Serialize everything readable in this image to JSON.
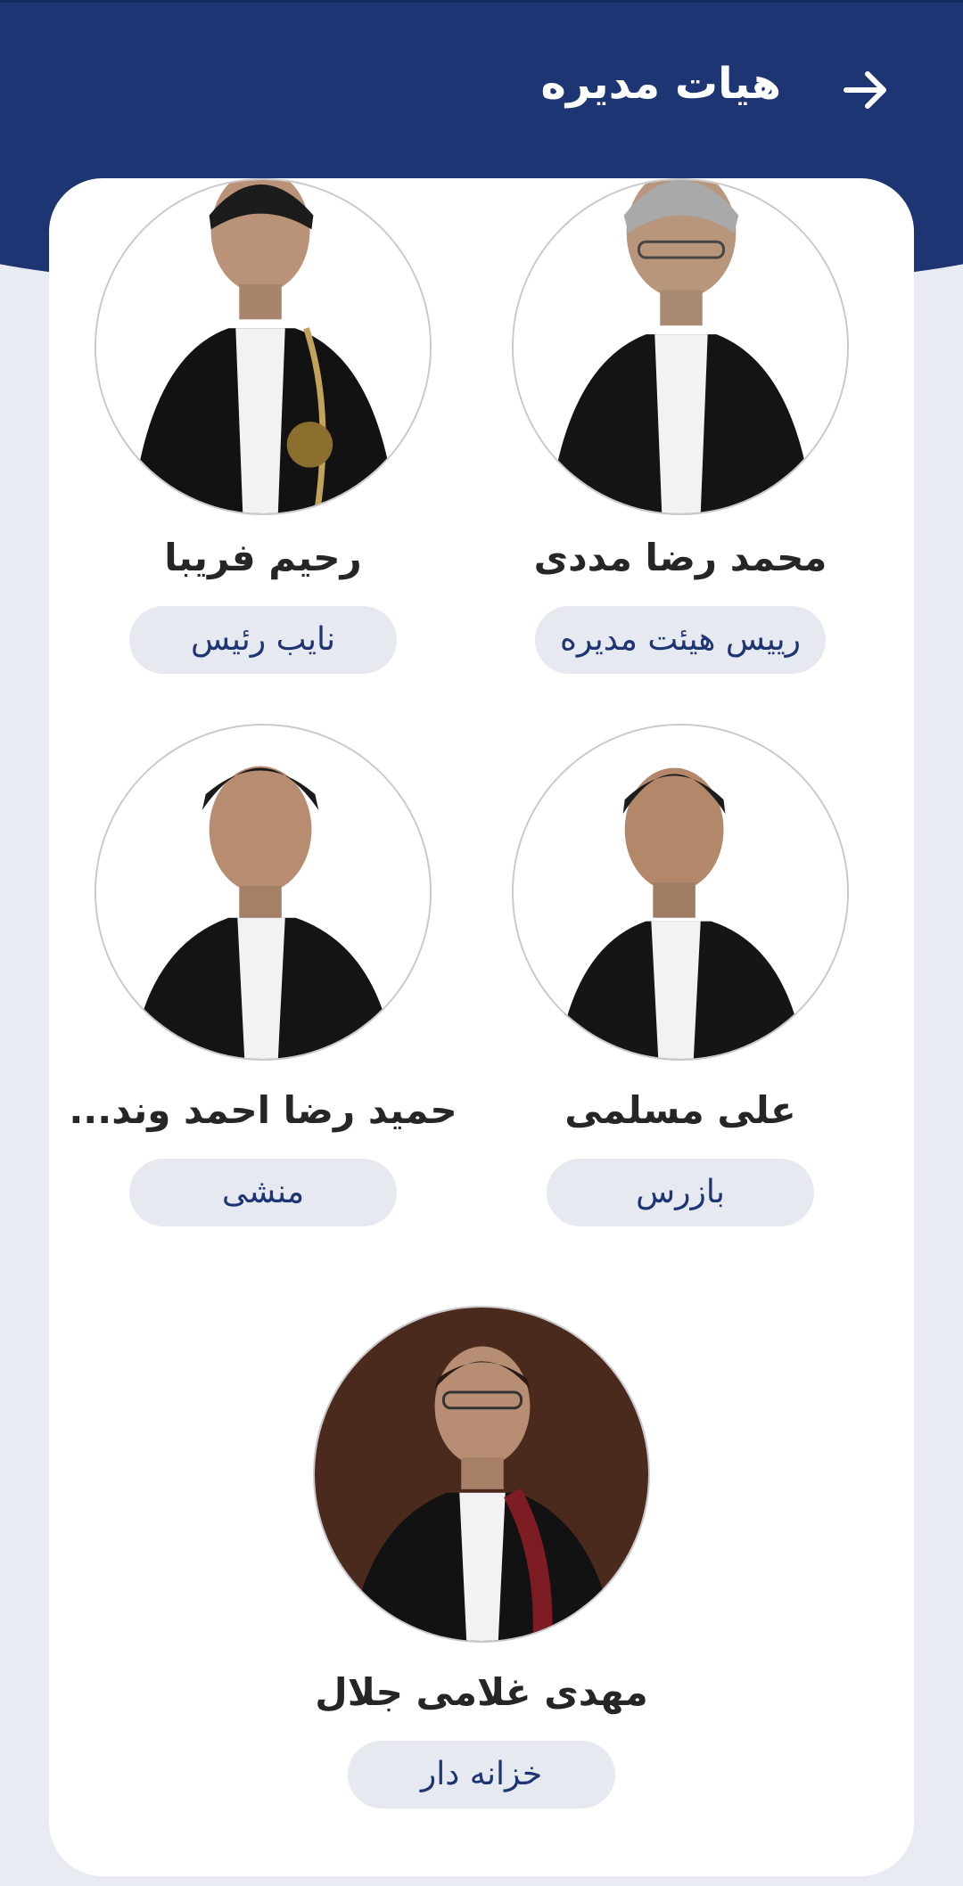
{
  "header": {
    "title": "هیات مدیره",
    "back_icon": "arrow-right-icon",
    "background_color": "#1d3573"
  },
  "members": [
    {
      "name": "محمد رضا مددی",
      "role": "رییس هیئت مدیره"
    },
    {
      "name": "رحیم فریبا",
      "role": "نایب رئیس"
    },
    {
      "name": "علی مسلمی",
      "role": "بازرس"
    },
    {
      "name": "حمید رضا احمد وند...",
      "role": "منشی"
    },
    {
      "name": "مهدی غلامی جلال",
      "role": "خزانه دار"
    }
  ],
  "colors": {
    "accent": "#1d3573",
    "badge_bg": "#e7e9f1",
    "page_bg": "#e8ebf2"
  }
}
